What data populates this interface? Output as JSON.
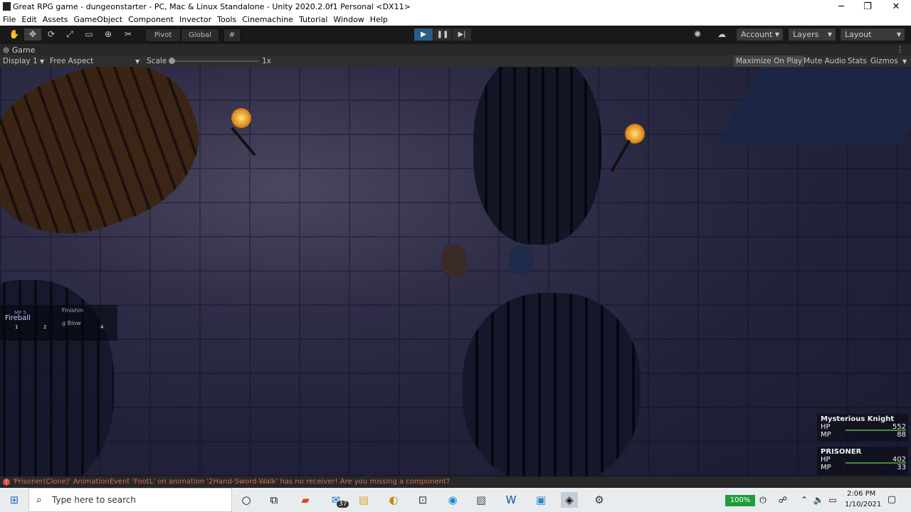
{
  "window": {
    "title": "Great RPG game - dungeonstarter - PC, Mac & Linux Standalone - Unity 2020.2.0f1 Personal <DX11>",
    "controls": [
      "─",
      "❐",
      "✕"
    ]
  },
  "menu": [
    "File",
    "Edit",
    "Assets",
    "GameObject",
    "Component",
    "Invector",
    "Tools",
    "Cinemachine",
    "Tutorial",
    "Window",
    "Help"
  ],
  "toolbar": {
    "pivot": "Pivot",
    "global": "Global",
    "account": "Account",
    "layers": "Layers",
    "layout": "Layout"
  },
  "game_view": {
    "tab": "Game",
    "display": "Display 1",
    "aspect": "Free Aspect",
    "scale_label": "Scale",
    "scale_value": "1x",
    "scale_fraction": 0.0,
    "maximize": "Maximize On Play",
    "mute": "Mute Audio",
    "stats": "Stats",
    "gizmos": "Gizmos"
  },
  "hud": {
    "skill_1": "Fireball",
    "skill_1_cost": "MP 5",
    "skill_1_key": "1",
    "skill_2_key": "2",
    "skill_3_line1": "Finishin",
    "skill_3_line2": "g Blow",
    "skill_4_key": "4",
    "party": [
      {
        "name": "Mysterious Knight",
        "hp_label": "HP",
        "hp": "552",
        "mp_label": "MP",
        "mp": "88"
      },
      {
        "name": "PRISONER",
        "hp_label": "HP",
        "hp": "402",
        "mp_label": "MP",
        "mp": "33"
      }
    ]
  },
  "console": {
    "error": "'Prisoner(Clone)' AnimationEvent 'FootL' on animation '2Hand-Sword-Walk' has no receiver! Are you missing a component?"
  },
  "taskbar": {
    "search_placeholder": "Type here to search",
    "mail_badge": "37",
    "battery": "100%",
    "time": "2:06 PM",
    "date": "1/10/2021"
  },
  "colors": {
    "play_active": "#2c5d87",
    "error": "#d86c54",
    "battery": "#1f9e3a"
  }
}
